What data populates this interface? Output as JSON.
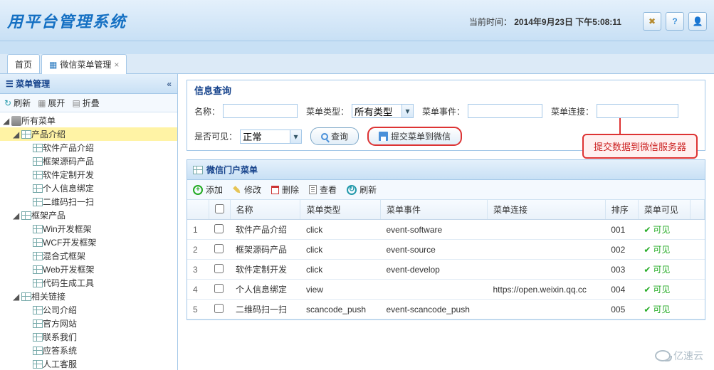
{
  "header": {
    "logo": "用平台管理系统",
    "time_label": "当前时间：",
    "time_value": "2014年9月23日 下午5:08:11"
  },
  "tabs": {
    "home": "首页",
    "menu_mgmt": "微信菜单管理",
    "close_char": "×"
  },
  "sidebar": {
    "title": "菜单管理",
    "collapse": "«",
    "toolbar": {
      "refresh": "刷新",
      "expand": "展开",
      "collapse_all": "折叠"
    },
    "tree": {
      "root": "所有菜单",
      "n1": "产品介绍",
      "n1_1": "软件产品介绍",
      "n1_2": "框架源码产品",
      "n1_3": "软件定制开发",
      "n1_4": "个人信息绑定",
      "n1_5": "二维码扫一扫",
      "n2": "框架产品",
      "n2_1": "Win开发框架",
      "n2_2": "WCF开发框架",
      "n2_3": "混合式框架",
      "n2_4": "Web开发框架",
      "n2_5": "代码生成工具",
      "n3": "相关链接",
      "n3_1": "公司介绍",
      "n3_2": "官方网站",
      "n3_3": "联系我们",
      "n3_4": "应答系统",
      "n3_5": "人工客服"
    }
  },
  "query": {
    "title": "信息查询",
    "name_label": "名称：",
    "type_label": "菜单类型：",
    "type_value": "所有类型",
    "event_label": "菜单事件：",
    "link_label": "菜单连接：",
    "visible_label": "是否可见：",
    "visible_value": "正常",
    "search_btn": "查询",
    "submit_btn": "提交菜单到微信"
  },
  "callout": "提交数据到微信服务器",
  "list": {
    "title": "微信门户菜单",
    "toolbar": {
      "add": "添加",
      "edit": "修改",
      "delete": "删除",
      "view": "查看",
      "refresh": "刷新"
    },
    "columns": {
      "name": "名称",
      "type": "菜单类型",
      "event": "菜单事件",
      "link": "菜单连接",
      "order": "排序",
      "visible": "菜单可见"
    },
    "visible_text": "可见",
    "rows": [
      {
        "idx": "1",
        "name": "软件产品介绍",
        "type": "click",
        "event": "event-software",
        "link": "",
        "order": "001"
      },
      {
        "idx": "2",
        "name": "框架源码产品",
        "type": "click",
        "event": "event-source",
        "link": "",
        "order": "002"
      },
      {
        "idx": "3",
        "name": "软件定制开发",
        "type": "click",
        "event": "event-develop",
        "link": "",
        "order": "003"
      },
      {
        "idx": "4",
        "name": "个人信息绑定",
        "type": "view",
        "event": "",
        "link": "https://open.weixin.qq.cc",
        "order": "004"
      },
      {
        "idx": "5",
        "name": "二维码扫一扫",
        "type": "scancode_push",
        "event": "event-scancode_push",
        "link": "",
        "order": "005"
      }
    ]
  },
  "watermark": "亿速云"
}
